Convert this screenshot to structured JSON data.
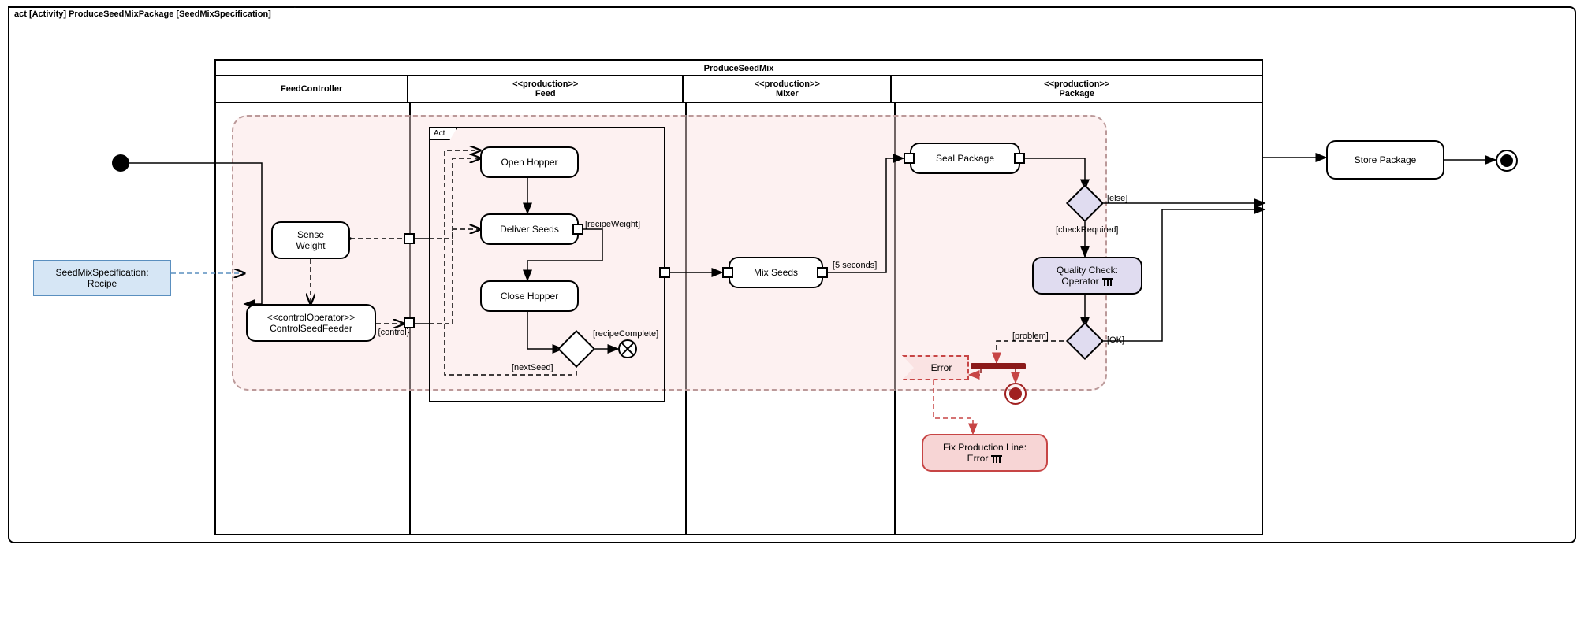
{
  "frame": {
    "header": "act [Activity] ProduceSeedMixPackage [SeedMixSpecification]"
  },
  "swimlane": {
    "title": "ProduceSeedMix",
    "lanes": [
      {
        "name": "FeedController",
        "stereotype": ""
      },
      {
        "name": "Feed",
        "stereotype": "<<production>>"
      },
      {
        "name": "Mixer",
        "stereotype": "<<production>>"
      },
      {
        "name": "Package",
        "stereotype": "<<production>>"
      }
    ]
  },
  "input": {
    "label": "SeedMixSpecification:\nRecipe"
  },
  "actions": {
    "senseWeight": "Sense\nWeight",
    "controlSeedFeeder": {
      "stereo": "<<controlOperator>>",
      "name": "ControlSeedFeeder"
    },
    "openHopper": "Open Hopper",
    "deliverSeeds": "Deliver Seeds",
    "closeHopper": "Close Hopper",
    "mixSeeds": "Mix Seeds",
    "sealPackage": "Seal Package",
    "qualityCheck": "Quality Check:\nOperator",
    "storePackage": "Store Package",
    "fixProduction": "Fix Production Line:\nError",
    "errorSignal": "Error"
  },
  "structured": {
    "actTab": "Act"
  },
  "guards": {
    "control": "{control}",
    "recipeWeight": "[recipeWeight]",
    "nextSeed": "[nextSeed]",
    "recipeComplete": "[recipeComplete]",
    "fiveSeconds": "[5 seconds]",
    "else": "[else]",
    "checkRequired": "[checkRequired]",
    "problem": "[problem]",
    "ok": "[OK]"
  }
}
